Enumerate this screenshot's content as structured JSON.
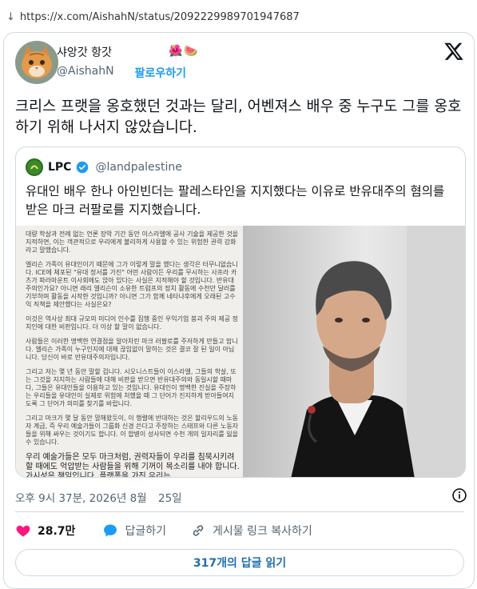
{
  "browser": {
    "url": "https://x.com/AishahN/status/2092229989701947687"
  },
  "author": {
    "display_name": "샤앙갓 항갓",
    "handle": "@AishahN",
    "emoji": "🌺🍉",
    "follow_label": "팔로우하기"
  },
  "tweet": {
    "text": "크리스 프랫을 옹호했던 것과는 달리, 어벤져스 배우 중 누구도 그를 옹호하기 위해 나서지 않았습니다."
  },
  "quoted": {
    "name": "LPC",
    "handle": "@landpalestine",
    "text": "유대인 배우 한나 아인빈더는 팔레스타인을 지지했다는 이유로 반유대주의 혐의를 받은 마크 러팔로를 지지했습니다.",
    "document_paragraphs": [
      "대량 학살과 전례 없는 언론 장악 기간 동안 이스라엘에 공사 기술을 제공한 것을 지적하면, 이는 객관적으로 우리에게 불리하게 사용할 수 있는 위험한 권력 강화라고 말했습니다.",
      "엘리슨 가족이 유대인이기 때문에 그가 이렇게 말을 했다는 생각은 터무니없습니다. ICE에 체포된 \"유대 정서를 가진\" 어떤 사람이든 우리를 무시하는 사프라 카츠가 파라마운트 이사회에도 앉아 있다는 사실은 지적해야 할 것입니다. 반유대주의인가요? 아니면 래리 엘리슨이 소유한 트럼프의 정치 활동에 수천만 달러를 기부하며 활동을 시작한 것입니까? 아니면 그가 함께 네타냐후에게 오래된 고수익 직책을 제안했다는 사실은요?",
      "이것은 역사상 최대 규모의 미디어 인수를 집행 중인 우익기업 붕괴 주의 제공 정치인에 대한 비판입니다. 더 이상 할 말이 없습니다.",
      "사람들은 이러한 명백한 연결점을 알아차린 마크 러팔로를 주저하게 만들고 맙니다. 엘리슨 가족이 누구인지에 대해 끊임없이 말하는 것은 결코 잘 된 일이 아닙니다. 당신이 바로 반유대주의자입니다.",
      "그리고 저는 몇 년 동안 말할 겁니다. 시오니스트들이 이스라엘, 그들의 학살, 또는 그것을 지지하는 사람들에 대해 비판을 받으면 반유대주의와 동일시할 때마다, 그들은 유대인들을 이용하고 있는 것입니다. 유대인이 명백한 진실을 주장하는 우리들을 유대인이 실제로 위험에 처했을 때 그 단어가 진지하게 받아들여지도록 그 단어가 의미를 찾기를 바랍니다.",
      "그리고 마크가 몇 달 동안 말해왔듯이, 이 행렬에 반대하는 것은 할리우드의 노동자 계급, 즉 우리 예술가들이 그룹화 신경 쓴다고 주장하는 스태프와 다른 노동자들을 위해 싸우는 것이기도 합니다. 이 합병이 성사되면 수천 개의 일자리를 잃을 수 있습니다.",
      "우리 예술가들은 모두 마크처럼, 권력자들이 우리를 침묵시키려 할 때에도 억압받는 사람들을 위해 기꺼이 목소리를 내야 합니다. 가시성은 책임입니다. 플랫폼을 가진 우리는"
    ]
  },
  "timestamp": {
    "time": "오후 9시 37분, 2026년 8월",
    "day": "25일"
  },
  "actions": {
    "likes": "28.7만",
    "reply_label": "답글하기",
    "copy_link_label": "게시물 링크 복사하기"
  },
  "replies_button": {
    "count": "317개",
    "label": "의 답글 읽기"
  },
  "colors": {
    "accent_blue": "#1d9bf0",
    "heart_pink": "#f91880",
    "border": "#cfd9de"
  },
  "icons": {
    "platform": "x-logo-icon",
    "verified": "verified-badge-icon",
    "like": "heart-icon",
    "reply": "speech-bubble-icon",
    "copy_link": "link-icon",
    "info": "info-icon"
  }
}
